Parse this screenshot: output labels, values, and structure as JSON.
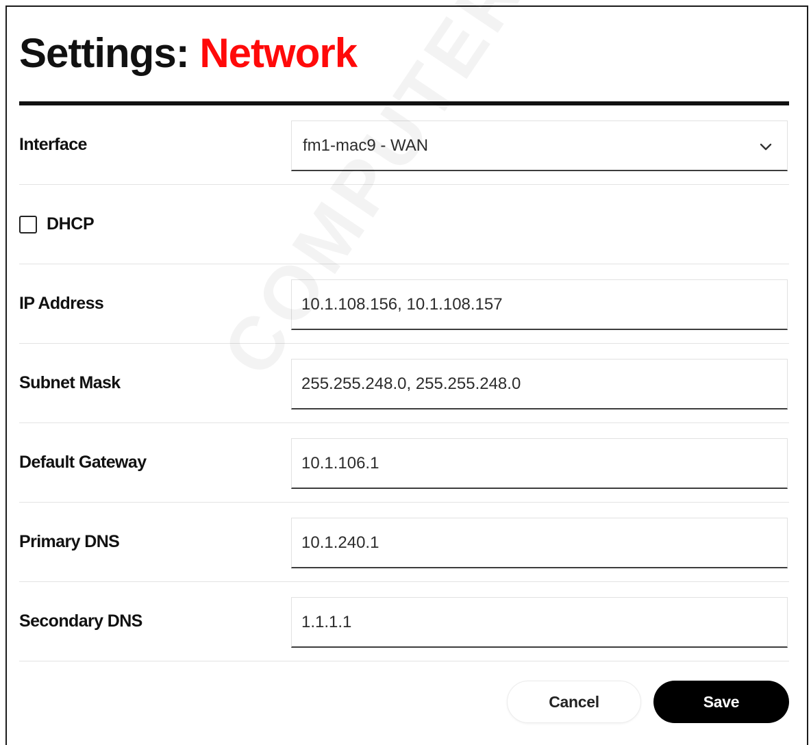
{
  "header": {
    "title_prefix": "Settings:",
    "title_accent": "Network",
    "accent_color": "#ff0a0a"
  },
  "interface": {
    "label": "Interface",
    "selected": "fm1-mac9 - WAN",
    "icon": "chevron-down-icon"
  },
  "dhcp": {
    "label": "DHCP",
    "checked": false
  },
  "fields": {
    "ip_address": {
      "label": "IP Address",
      "value": "10.1.108.156, 10.1.108.157"
    },
    "subnet_mask": {
      "label": "Subnet Mask",
      "value": "255.255.248.0, 255.255.248.0"
    },
    "default_gateway": {
      "label": "Default Gateway",
      "value": "10.1.106.1"
    },
    "primary_dns": {
      "label": "Primary DNS",
      "value": "10.1.240.1"
    },
    "secondary_dns": {
      "label": "Secondary DNS",
      "value": "1.1.1.1"
    }
  },
  "actions": {
    "cancel_label": "Cancel",
    "save_label": "Save"
  },
  "watermark": "COMPUTER CORPORATION"
}
